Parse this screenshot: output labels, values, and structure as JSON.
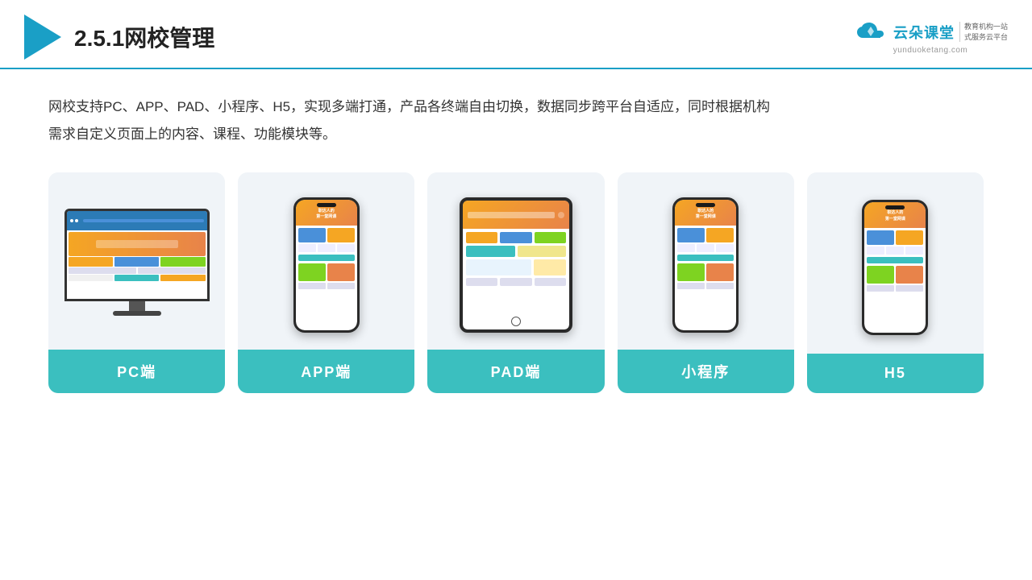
{
  "header": {
    "title": "2.5.1网校管理",
    "brand": {
      "name": "云朵课堂",
      "tagline": "教育机构一站\n式服务云平台",
      "url": "yunduoketang.com"
    }
  },
  "description": "网校支持PC、APP、PAD、小程序、H5，实现多端打通，产品各终端自由切换，数据同步跨平台自适应，同时根据机构\n需求自定义页面上的内容、课程、功能模块等。",
  "cards": [
    {
      "id": "pc",
      "label": "PC端"
    },
    {
      "id": "app",
      "label": "APP端"
    },
    {
      "id": "pad",
      "label": "PAD端"
    },
    {
      "id": "miniapp",
      "label": "小程序"
    },
    {
      "id": "h5",
      "label": "H5"
    }
  ],
  "accent_color": "#3bbfbf",
  "title_color": "#222"
}
